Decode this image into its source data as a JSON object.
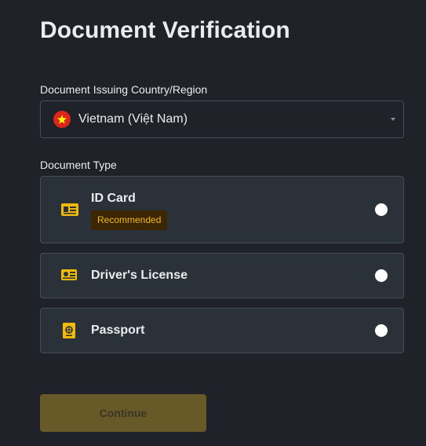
{
  "page": {
    "title": "Document Verification"
  },
  "country_field": {
    "label": "Document Issuing Country/Region",
    "value": "Vietnam (Việt Nam)",
    "flag_icon": "vietnam-flag-icon"
  },
  "document_type": {
    "label": "Document Type",
    "options": [
      {
        "label": "ID Card",
        "badge": "Recommended",
        "icon": "id-card-icon"
      },
      {
        "label": "Driver's License",
        "icon": "drivers-license-icon"
      },
      {
        "label": "Passport",
        "icon": "passport-icon"
      }
    ]
  },
  "actions": {
    "continue_label": "Continue",
    "continue_enabled": false
  },
  "colors": {
    "background": "#1f2228",
    "card": "#2b3139",
    "border": "#474d57",
    "accent": "#f0b90b",
    "badge_bg": "#3c2601",
    "button_disabled": "#685a28"
  }
}
